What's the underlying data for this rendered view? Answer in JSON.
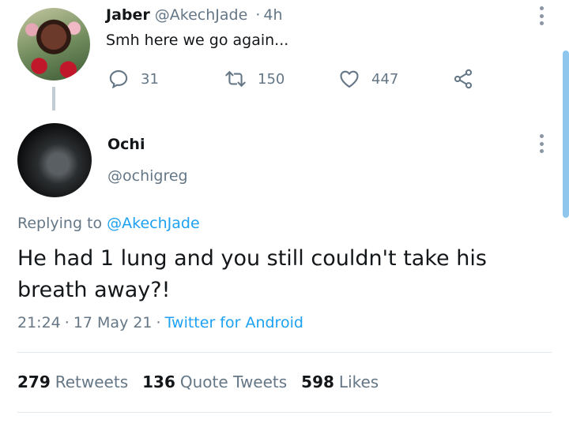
{
  "parent_tweet": {
    "display_name": "Jaber",
    "handle": "@AkechJade",
    "separator": "·",
    "time": "4h",
    "text": "Smh here we go again...",
    "reply_count": "31",
    "retweet_count": "150",
    "like_count": "447"
  },
  "focused_tweet": {
    "display_name": "Ochi",
    "handle": "@ochigreg",
    "replying_label": "Replying to",
    "replying_handle": "@AkechJade",
    "text": "He had 1 lung and you still couldn't take his breath away?!",
    "time": "21:24",
    "date": "17 May 21",
    "separator": "·",
    "source": "Twitter for Android"
  },
  "stats": {
    "retweets_count": "279",
    "retweets_label": "Retweets",
    "quotes_count": "136",
    "quotes_label": "Quote Tweets",
    "likes_count": "598",
    "likes_label": "Likes"
  },
  "icons": {
    "reply": "reply-icon",
    "retweet": "retweet-icon",
    "like": "heart-icon",
    "share": "share-icon",
    "more": "more-vertical-icon"
  },
  "colors": {
    "link": "#1da1f2",
    "muted": "#657786",
    "text": "#14171a",
    "scrollbar": "#8fc6ee"
  }
}
